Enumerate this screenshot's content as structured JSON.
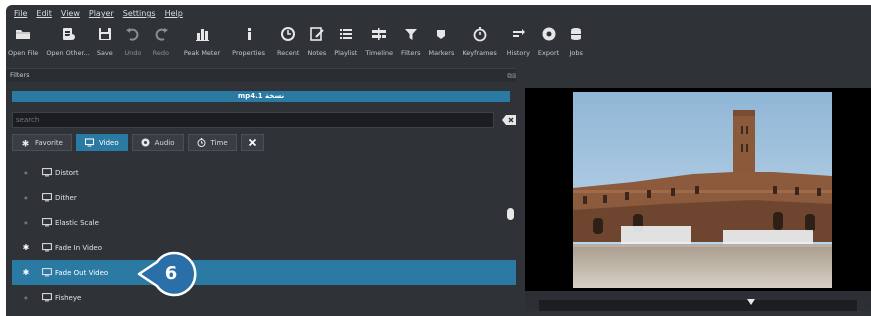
{
  "menu": [
    "File",
    "Edit",
    "View",
    "Player",
    "Settings",
    "Help"
  ],
  "toolbar": [
    {
      "id": "open-file",
      "label": "Open File",
      "icon": "folder-icon",
      "disabled": false
    },
    {
      "id": "open-other",
      "label": "Open Other...",
      "icon": "open-other-icon",
      "disabled": false
    },
    {
      "id": "save",
      "label": "Save",
      "icon": "save-icon",
      "disabled": false
    },
    {
      "id": "undo",
      "label": "Undo",
      "icon": "undo-icon",
      "disabled": true
    },
    {
      "id": "redo",
      "label": "Redo",
      "icon": "redo-icon",
      "disabled": true
    },
    {
      "id": "peak-meter",
      "label": "Peak Meter",
      "icon": "peak-meter-icon",
      "disabled": false
    },
    {
      "id": "properties",
      "label": "Properties",
      "icon": "info-icon",
      "disabled": false
    },
    {
      "id": "recent",
      "label": "Recent",
      "icon": "clock-icon",
      "disabled": false
    },
    {
      "id": "notes",
      "label": "Notes",
      "icon": "notes-icon",
      "disabled": false
    },
    {
      "id": "playlist",
      "label": "Playlist",
      "icon": "playlist-icon",
      "disabled": false
    },
    {
      "id": "timeline",
      "label": "Timeline",
      "icon": "timeline-icon",
      "disabled": false
    },
    {
      "id": "filters",
      "label": "Filters",
      "icon": "filter-icon",
      "disabled": false
    },
    {
      "id": "markers",
      "label": "Markers",
      "icon": "marker-icon",
      "disabled": false
    },
    {
      "id": "keyframes",
      "label": "Keyframes",
      "icon": "stopwatch-icon",
      "disabled": false
    },
    {
      "id": "history",
      "label": "History",
      "icon": "history-icon",
      "disabled": false
    },
    {
      "id": "export",
      "label": "Export",
      "icon": "export-icon",
      "disabled": false
    },
    {
      "id": "jobs",
      "label": "Jobs",
      "icon": "jobs-icon",
      "disabled": false
    }
  ],
  "filters_panel": {
    "title": "Filters",
    "clip_name": "mp4.1 نسخة",
    "search_placeholder": "search",
    "tabs": [
      {
        "label": "Favorite",
        "icon": "star-icon",
        "active": false
      },
      {
        "label": "Video",
        "icon": "monitor-icon",
        "active": true
      },
      {
        "label": "Audio",
        "icon": "speaker-icon",
        "active": false
      },
      {
        "label": "Time",
        "icon": "clock-icon",
        "active": false
      }
    ],
    "items": [
      {
        "name": "Distort",
        "favorite": false,
        "selected": false
      },
      {
        "name": "Dither",
        "favorite": false,
        "selected": false
      },
      {
        "name": "Elastic Scale",
        "favorite": false,
        "selected": false
      },
      {
        "name": "Fade In Video",
        "favorite": true,
        "selected": false
      },
      {
        "name": "Fade Out Video",
        "favorite": true,
        "selected": true
      },
      {
        "name": "Fisheye",
        "favorite": false,
        "selected": false
      }
    ]
  },
  "callout": {
    "number": "6"
  },
  "colors": {
    "accent": "#2a7aa4",
    "callout": "#2a6fa8",
    "background": "#2f3237"
  }
}
